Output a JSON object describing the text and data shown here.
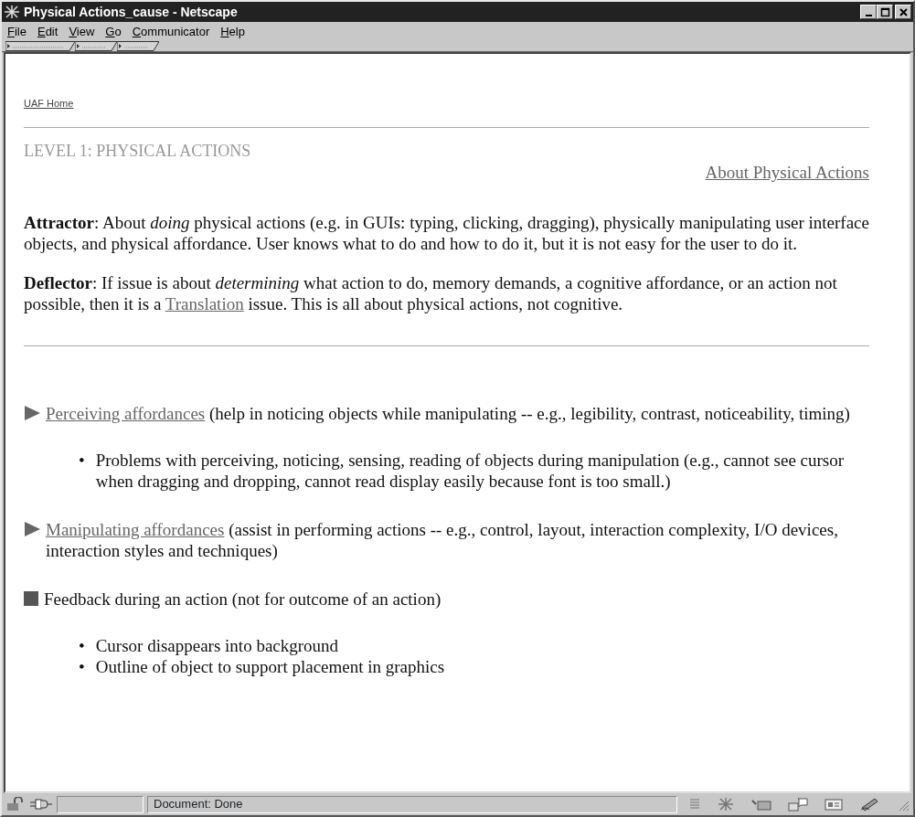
{
  "window": {
    "title": "Physical Actions_cause - Netscape"
  },
  "menu": [
    "File",
    "Edit",
    "View",
    "Go",
    "Communicator",
    "Help"
  ],
  "page": {
    "home_link": "UAF Home",
    "heading": "LEVEL 1: PHYSICAL ACTIONS",
    "about_link": "About Physical Actions",
    "paragraphs": [
      [
        {
          "kind": "text",
          "text": "**Attractor**: About *doing* physical actions (e.g. in GUIs: typing, clicking, dragging), physically manipulating user interface objects, and physical affordance. User knows what to do and how to do it, but it is not easy for the user to do it."
        }
      ],
      [
        {
          "kind": "text",
          "text": "**Deflector**: If issue is about *determining* what action to do, memory demands, a cognitive affordance, or an action not possible, then it is a "
        },
        {
          "kind": "link",
          "text": "Translation"
        },
        {
          "kind": "text",
          "text": " issue. This is all about physical actions, not cognitive."
        }
      ]
    ],
    "sections": [
      {
        "kind": "triangle",
        "link": "Perceiving affordances",
        "text": " (help in noticing objects while manipulating -- e.g., legibility, contrast, noticeability, timing)",
        "bullets": [
          {
            "marker": "•",
            "text": "Problems with perceiving, noticing, sensing, reading of objects during manipulation (e.g., cannot see cursor when dragging and dropping, cannot read display easily because font is too small.)"
          }
        ]
      },
      {
        "kind": "triangle",
        "link": "Manipulating affordances",
        "text": " (assist in performing actions -- e.g., control, layout, interaction complexity, I/O devices, interaction styles and techniques)"
      },
      {
        "kind": "square",
        "text": "Feedback during an action (not for outcome of an action)",
        "bullets": [
          {
            "marker": "•",
            "text": "Cursor disappears into background"
          },
          {
            "marker": "•",
            "text": "Outline of object to support placement in graphics"
          }
        ]
      }
    ]
  },
  "status_bar": {
    "text": "Document: Done"
  }
}
